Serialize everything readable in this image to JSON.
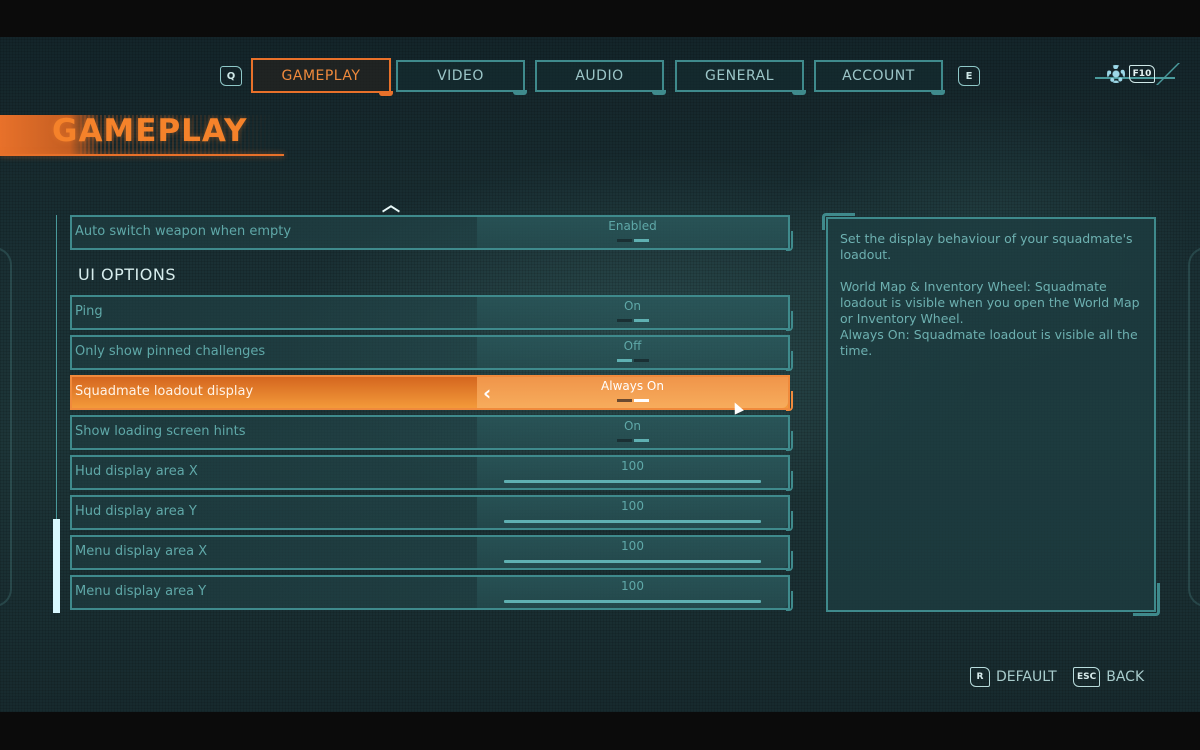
{
  "nav": {
    "prev_key": "Q",
    "next_key": "E",
    "tabs": [
      {
        "label": "GAMEPLAY",
        "active": true
      },
      {
        "label": "VIDEO",
        "active": false
      },
      {
        "label": "AUDIO",
        "active": false
      },
      {
        "label": "GENERAL",
        "active": false
      },
      {
        "label": "ACCOUNT",
        "active": false
      }
    ],
    "settings_key": "F10",
    "settings_icon": "gear-icon"
  },
  "page": {
    "title": "GAMEPLAY"
  },
  "settings": {
    "scroll_up_icon": "^",
    "rows": [
      {
        "label": "Auto switch weapon when empty",
        "type": "toggle",
        "value": "Enabled",
        "option_index": 1,
        "option_count": 2
      },
      {
        "label": "Ping",
        "type": "toggle",
        "value": "On",
        "option_index": 1,
        "option_count": 2
      },
      {
        "label": "Only show pinned challenges",
        "type": "toggle",
        "value": "Off",
        "option_index": 0,
        "option_count": 2
      },
      {
        "label": "Squadmate loadout display",
        "type": "toggle",
        "value": "Always On",
        "option_index": 1,
        "option_count": 2,
        "selected": true
      },
      {
        "label": "Show loading screen hints",
        "type": "toggle",
        "value": "On",
        "option_index": 1,
        "option_count": 2
      },
      {
        "label": "Hud display area X",
        "type": "slider",
        "value": "100",
        "fill_percent": 100
      },
      {
        "label": "Hud display area Y",
        "type": "slider",
        "value": "100",
        "fill_percent": 100
      },
      {
        "label": "Menu display area X",
        "type": "slider",
        "value": "100",
        "fill_percent": 100
      },
      {
        "label": "Menu display area Y",
        "type": "slider",
        "value": "100",
        "fill_percent": 100
      }
    ],
    "section_ui_options": "UI OPTIONS",
    "arrow_left": "‹"
  },
  "description": {
    "text": "Set the display behaviour of your squadmate's loadout.\n\nWorld Map & Inventory Wheel: Squadmate loadout is visible when you open the World Map or Inventory Wheel.\nAlways On: Squadmate loadout is visible all the time."
  },
  "footer": {
    "default_key": "R",
    "default_label": "DEFAULT",
    "back_key": "ESC",
    "back_label": "BACK"
  },
  "colors": {
    "accent_orange": "#e8712a",
    "teal_border": "#3f8a8c",
    "teal_text": "#5fa8a8"
  }
}
